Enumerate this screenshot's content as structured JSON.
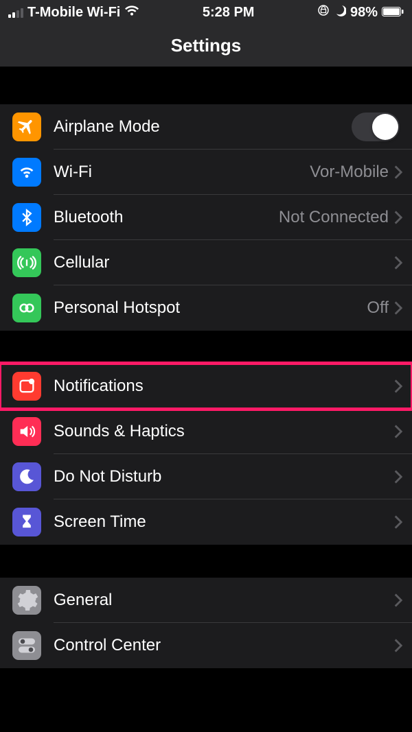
{
  "status": {
    "carrier": "T-Mobile Wi-Fi",
    "time": "5:28 PM",
    "battery": "98%"
  },
  "header": {
    "title": "Settings"
  },
  "group1": [
    {
      "name": "airplane-mode",
      "label": "Airplane Mode",
      "icon_color": "#ff9500",
      "toggle": false
    },
    {
      "name": "wifi",
      "label": "Wi-Fi",
      "icon_color": "#007aff",
      "value": "Vor-Mobile"
    },
    {
      "name": "bluetooth",
      "label": "Bluetooth",
      "icon_color": "#007aff",
      "value": "Not Connected"
    },
    {
      "name": "cellular",
      "label": "Cellular",
      "icon_color": "#34c759"
    },
    {
      "name": "personal-hotspot",
      "label": "Personal Hotspot",
      "icon_color": "#34c759",
      "value": "Off"
    }
  ],
  "group2": [
    {
      "name": "notifications",
      "label": "Notifications",
      "icon_color": "#ff3b30",
      "highlighted": true
    },
    {
      "name": "sounds",
      "label": "Sounds & Haptics",
      "icon_color": "#ff2d55"
    },
    {
      "name": "dnd",
      "label": "Do Not Disturb",
      "icon_color": "#5856d6"
    },
    {
      "name": "screen-time",
      "label": "Screen Time",
      "icon_color": "#5856d6"
    }
  ],
  "group3": [
    {
      "name": "general",
      "label": "General",
      "icon_color": "#8e8e93"
    },
    {
      "name": "control-center",
      "label": "Control Center",
      "icon_color": "#8e8e93"
    }
  ]
}
